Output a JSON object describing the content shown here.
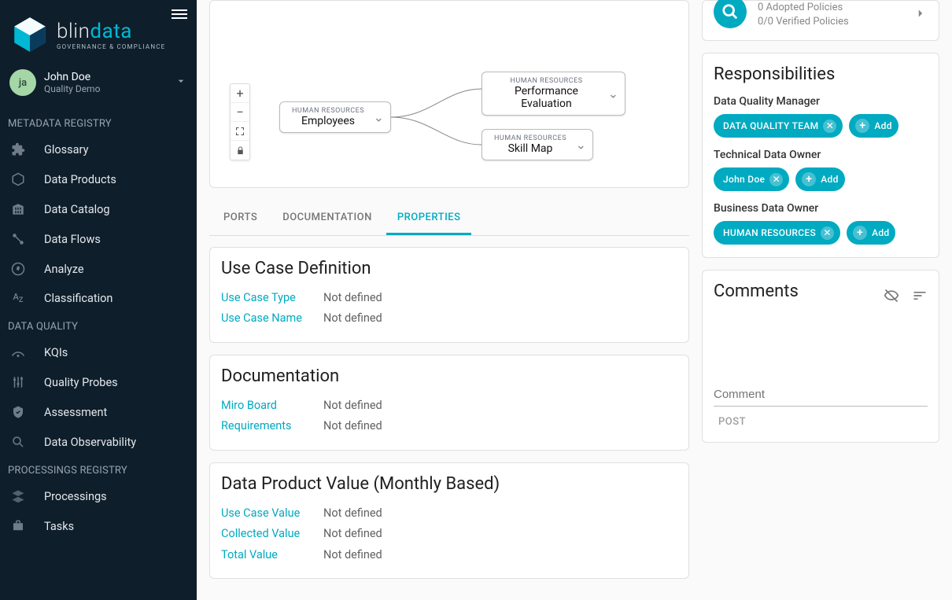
{
  "app": {
    "name": "blindata",
    "tagline": "GOVERNANCE & COMPLIANCE"
  },
  "user": {
    "initials": "ja",
    "name": "John Doe",
    "subtitle": "Quality Demo"
  },
  "sidebar": {
    "sections": [
      {
        "title": "METADATA REGISTRY",
        "items": [
          {
            "label": "Glossary"
          },
          {
            "label": "Data Products"
          },
          {
            "label": "Data Catalog"
          },
          {
            "label": "Data Flows"
          },
          {
            "label": "Analyze"
          },
          {
            "label": "Classification"
          }
        ]
      },
      {
        "title": "DATA QUALITY",
        "items": [
          {
            "label": "KQIs"
          },
          {
            "label": "Quality Probes"
          },
          {
            "label": "Assessment"
          },
          {
            "label": "Data Observability"
          }
        ]
      },
      {
        "title": "PROCESSINGS REGISTRY",
        "items": [
          {
            "label": "Processings"
          },
          {
            "label": "Tasks"
          }
        ]
      }
    ]
  },
  "graph": {
    "nodes": [
      {
        "category": "HUMAN RESOURCES",
        "title": "Employees"
      },
      {
        "category": "HUMAN RESOURCES",
        "title": "Performance Evaluation"
      },
      {
        "category": "HUMAN RESOURCES",
        "title": "Skill Map"
      }
    ]
  },
  "tabs": {
    "items": [
      "PORTS",
      "DOCUMENTATION",
      "PROPERTIES"
    ],
    "active": 2
  },
  "panels": [
    {
      "title": "Use Case Definition",
      "rows": [
        {
          "k": "Use Case Type",
          "v": "Not defined"
        },
        {
          "k": "Use Case Name",
          "v": "Not defined"
        }
      ]
    },
    {
      "title": "Documentation",
      "rows": [
        {
          "k": "Miro Board",
          "v": "Not defined"
        },
        {
          "k": "Requirements",
          "v": "Not defined"
        }
      ]
    },
    {
      "title": "Data Product Value (Monthly Based)",
      "rows": [
        {
          "k": "Use Case Value",
          "v": "Not defined"
        },
        {
          "k": "Collected Value",
          "v": "Not defined"
        },
        {
          "k": "Total Value",
          "v": "Not defined"
        }
      ]
    }
  ],
  "policies": {
    "line1": "0 Adopted Policies",
    "line2": "0/0 Verified Policies"
  },
  "responsibilities": {
    "title": "Responsibilities",
    "roles": [
      {
        "name": "Data Quality Manager",
        "chips": [
          "DATA QUALITY TEAM"
        ],
        "add": "Add"
      },
      {
        "name": "Technical Data Owner",
        "chips": [
          "John Doe"
        ],
        "add": "Add"
      },
      {
        "name": "Business Data Owner",
        "chips": [
          "HUMAN RESOURCES"
        ],
        "add": "Add"
      }
    ]
  },
  "comments": {
    "title": "Comments",
    "placeholder": "Comment",
    "postLabel": "POST"
  }
}
